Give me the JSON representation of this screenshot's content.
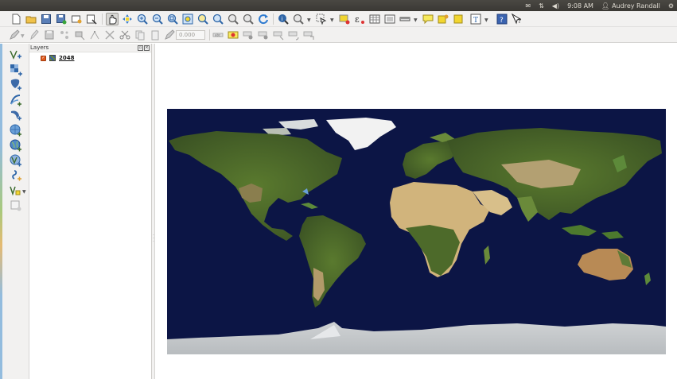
{
  "top_panel": {
    "time": "9:08 AM",
    "user": "Audrey Randall",
    "icons": [
      "mail-icon",
      "network-icon",
      "volume-icon",
      "user-icon",
      "gear-icon"
    ]
  },
  "toolbar_1": {
    "icons": [
      "new-project-icon",
      "open-project-icon",
      "save-project-icon",
      "save-as-icon",
      "new-print-composer-icon",
      "composer-manager-icon",
      "pan-map-icon",
      "pan-to-selection-icon",
      "zoom-in-icon",
      "zoom-out-icon",
      "zoom-full-icon",
      "zoom-to-selection-icon",
      "zoom-to-layer-icon",
      "zoom-last-icon",
      "zoom-next-icon",
      "refresh-icon",
      "identify-icon",
      "measure-icon",
      "select-features-icon",
      "deselect-icon",
      "field-calculator-icon",
      "attribute-table-icon",
      "statistics-icon",
      "measure-line-icon",
      "map-tips-icon",
      "new-bookmark-icon",
      "show-bookmarks-icon",
      "text-annotation-icon",
      "help-icon",
      "whats-this-icon"
    ]
  },
  "toolbar_2": {
    "icons": [
      "current-edits-icon",
      "toggle-editing-icon",
      "save-edits-icon",
      "add-feature-icon",
      "move-feature-icon",
      "node-tool-icon",
      "delete-selected-icon",
      "cut-features-icon",
      "copy-features-icon",
      "paste-features-icon",
      "rotate-point-symbols-icon",
      "label-icon",
      "pin-labels-icon",
      "show-hide-labels-icon",
      "move-label-icon",
      "rotate-label-icon",
      "change-label-icon",
      "layer-labeling-icon"
    ],
    "zoom_value": "0.000"
  },
  "left_tools": {
    "icons": [
      "add-vector-layer-icon",
      "add-raster-layer-icon",
      "add-postgis-layer-icon",
      "add-spatialite-layer-icon",
      "add-mssql-layer-icon",
      "add-wms-layer-icon",
      "add-wcs-layer-icon",
      "add-wfs-layer-icon",
      "add-delimited-text-icon",
      "new-shapefile-icon",
      "remove-layer-icon"
    ]
  },
  "layers_panel": {
    "title": "Layers",
    "items": [
      {
        "name": "2048",
        "checked": true
      }
    ]
  },
  "colors": {
    "ocean": "#0c1545",
    "land_green": "#4f6a2a",
    "desert": "#d1b47c",
    "ice": "#e8e8e6",
    "panel_bg": "#f2f1f0"
  }
}
